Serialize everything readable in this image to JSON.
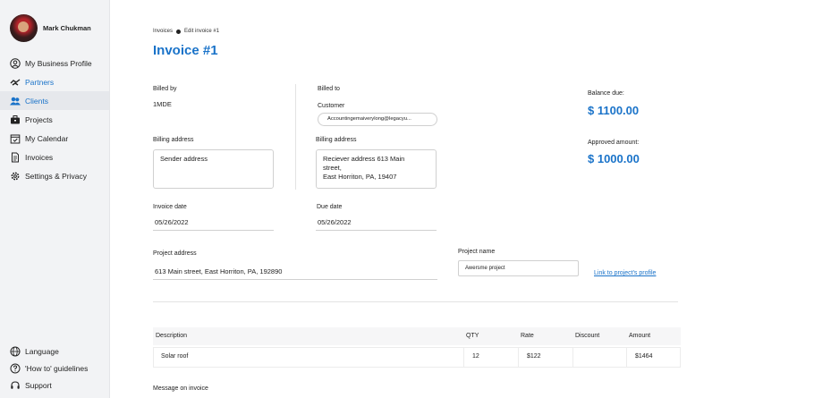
{
  "user": {
    "name": "Mark Chukman"
  },
  "nav": {
    "items": [
      {
        "label": "My Business Profile",
        "icon": "user-circle-icon"
      },
      {
        "label": "Partners",
        "icon": "handshake-icon"
      },
      {
        "label": "Clients",
        "icon": "users-icon",
        "active": true
      },
      {
        "label": "Projects",
        "icon": "briefcase-icon"
      },
      {
        "label": "My Calendar",
        "icon": "calendar-icon"
      },
      {
        "label": "Invoices",
        "icon": "document-icon"
      },
      {
        "label": "Settings & Privacy",
        "icon": "gear-icon"
      }
    ],
    "bottom": [
      {
        "label": "Language",
        "icon": "globe-icon"
      },
      {
        "label": "'How to' guidelines",
        "icon": "question-icon"
      },
      {
        "label": "Support",
        "icon": "headset-icon"
      }
    ]
  },
  "breadcrumb": {
    "parent": "Invoices",
    "current": "Edit invoice #1"
  },
  "title": "Invoice #1",
  "billed_by": {
    "label": "Billed by",
    "value": "1MDE"
  },
  "billed_to": {
    "label": "Billed to",
    "customer_label": "Customer",
    "customer_value": "Accountingemaiverylong@legacyu..."
  },
  "billing_address_from": {
    "label": "Billing address",
    "value": "Sender address"
  },
  "billing_address_to": {
    "label": "Billing address",
    "line1": "Reciever address 613 Main",
    "line2": "street,",
    "line3": "East Horriton, PA, 19407"
  },
  "balance": {
    "label": "Balance due:",
    "value": "$ 1100.00"
  },
  "approved": {
    "label": "Approved amount:",
    "value": "$ 1000.00"
  },
  "invoice_date": {
    "label": "Invoice date",
    "value": "05/26/2022"
  },
  "due_date": {
    "label": "Due date",
    "value": "05/26/2022"
  },
  "project_address": {
    "label": "Project address",
    "value": "613 Main street, East Horriton, PA, 192890"
  },
  "project_name": {
    "label": "Project name",
    "value": "Awersme project"
  },
  "project_link": "Link to project's profile",
  "table": {
    "headers": {
      "description": "Description",
      "qty": "QTY",
      "rate": "Rate",
      "discount": "Discount",
      "amount": "Amount"
    },
    "rows": [
      {
        "description": "Solar roof",
        "qty": "12",
        "rate": "$122",
        "discount": "",
        "amount": "$1464"
      }
    ]
  },
  "message_label": "Message on invoice",
  "colors": {
    "accent": "#1a73c9",
    "sidebar_bg": "#f2f3f5"
  }
}
